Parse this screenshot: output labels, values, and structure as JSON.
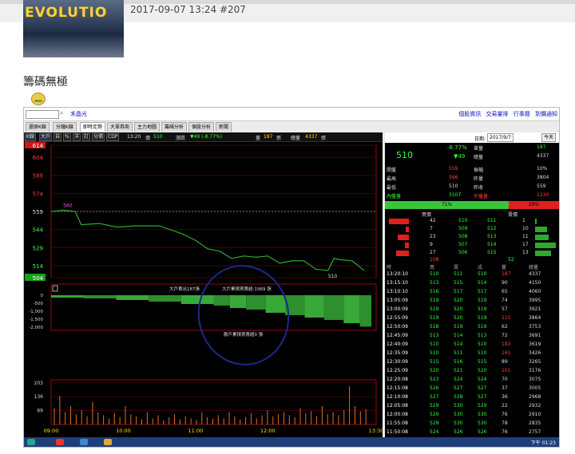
{
  "post": {
    "meta": "2017-09-07 13:24  #207",
    "title": "籌碼無極",
    "avatar_text": "EVOLUTIO"
  },
  "toolbar": {
    "stock_name": "禾晶光",
    "links": "個股資訊 交易量排 行事曆 到價通知"
  },
  "tabs": [
    "還原K線",
    "分鐘K線",
    "即時走勢",
    "大單券商",
    "主力地圖",
    "籌碼分析",
    "個股分析",
    "新聞"
  ],
  "chart_head": {
    "mode_buttons": [
      "K線",
      "大戶",
      "自",
      "%",
      "洋",
      "訂",
      "分價",
      "CDP"
    ],
    "time": "13:20",
    "price_label": "價",
    "price": "510",
    "change_label": "漲跌",
    "change": "▼49 (-8.77%)",
    "volume_label": "量",
    "volume": "187",
    "volume_unit": "張",
    "total_label": "總量",
    "total": "4337",
    "total_unit": "張"
  },
  "chart_data": {
    "type": "line",
    "price_axis_ticks": [
      "614",
      "604",
      "589",
      "574",
      "559",
      "544",
      "529",
      "514",
      "504"
    ],
    "price_line": [
      [
        "09:00",
        559
      ],
      [
        "09:10",
        560
      ],
      [
        "09:20",
        559
      ],
      [
        "09:25",
        548
      ],
      [
        "09:40",
        549
      ],
      [
        "09:55",
        546
      ],
      [
        "10:10",
        547
      ],
      [
        "10:30",
        547
      ],
      [
        "10:50",
        540
      ],
      [
        "11:00",
        535
      ],
      [
        "11:10",
        528
      ],
      [
        "11:20",
        526
      ],
      [
        "11:30",
        520
      ],
      [
        "11:40",
        522
      ],
      [
        "11:50",
        521
      ],
      [
        "12:00",
        522
      ],
      [
        "12:10",
        516
      ],
      [
        "12:20",
        518
      ],
      [
        "12:30",
        518
      ],
      [
        "12:40",
        511
      ],
      [
        "12:50",
        510
      ],
      [
        "12:55",
        520
      ],
      [
        "13:00",
        519
      ],
      [
        "13:10",
        518
      ],
      [
        "13:20",
        510
      ]
    ],
    "label_high": "560",
    "label_low": "510",
    "big_order_axis_ticks": [
      "0",
      "-500",
      "-1,000",
      "-1,500",
      "-2,000"
    ],
    "big_order_note_1": "大戶賣出187張",
    "big_order_note_2": "大戶累積買賣超-1969 張",
    "big_order_note_3": "散戶累積買賣超0 張",
    "volume_axis_ticks": [
      "203",
      "136",
      "69"
    ],
    "time_axis_ticks": [
      "09:00",
      "10:00",
      "11:00",
      "12:00",
      "13:30"
    ]
  },
  "right": {
    "date_label": "日期:",
    "date": "2017/9/7",
    "today_btn": "今天",
    "price": "510",
    "pct": "-8.77%",
    "change": "▼49",
    "stats_left": [
      [
        "開盤",
        "559"
      ],
      [
        "最高",
        "566"
      ],
      [
        "最低",
        "510"
      ],
      [
        "內盤量",
        "3107"
      ]
    ],
    "stats_right": [
      [
        "單量",
        "187"
      ],
      [
        "總量",
        "4337"
      ],
      [
        "振幅",
        "10%"
      ],
      [
        "昨量",
        "3804"
      ],
      [
        "昨收",
        "559"
      ],
      [
        "外盤量",
        "1230"
      ]
    ],
    "ratio_buy": "71%",
    "ratio_sell": "29%",
    "ob_headers": [
      "買價",
      "賣價"
    ],
    "order_book": [
      [
        "42",
        "510",
        "511",
        "1"
      ],
      [
        "7",
        "509",
        "512",
        "10"
      ],
      [
        "23",
        "508",
        "513",
        "11"
      ],
      [
        "9",
        "507",
        "514",
        "17"
      ],
      [
        "27",
        "506",
        "515",
        "13"
      ]
    ],
    "ob_totals": [
      "108",
      "52"
    ],
    "tick_headers": [
      "時",
      "買",
      "賣",
      "成",
      "量",
      "總量"
    ],
    "ticks": [
      [
        "13:20:10",
        "510",
        "511",
        "510",
        "187",
        "4337"
      ],
      [
        "13:15:10",
        "513",
        "515",
        "514",
        "90",
        "4150"
      ],
      [
        "13:10:10",
        "516",
        "517",
        "517",
        "65",
        "4060"
      ],
      [
        "13:05:09",
        "519",
        "520",
        "519",
        "74",
        "3995"
      ],
      [
        "13:00:09",
        "519",
        "520",
        "519",
        "57",
        "3921"
      ],
      [
        "12:55:09",
        "519",
        "520",
        "519",
        "111",
        "3864"
      ],
      [
        "12:50:09",
        "518",
        "519",
        "519",
        "62",
        "3753"
      ],
      [
        "12:45:09",
        "513",
        "514",
        "513",
        "72",
        "3691"
      ],
      [
        "12:40:09",
        "510",
        "514",
        "510",
        "183",
        "3619"
      ],
      [
        "12:35:09",
        "510",
        "511",
        "510",
        "161",
        "3426"
      ],
      [
        "12:30:09",
        "515",
        "516",
        "515",
        "89",
        "3265"
      ],
      [
        "12:25:09",
        "520",
        "521",
        "520",
        "101",
        "3176"
      ],
      [
        "12:20:08",
        "523",
        "524",
        "524",
        "70",
        "3075"
      ],
      [
        "12:15:08",
        "526",
        "527",
        "527",
        "37",
        "3005"
      ],
      [
        "12:10:08",
        "527",
        "528",
        "527",
        "36",
        "2968"
      ],
      [
        "12:05:08",
        "529",
        "530",
        "529",
        "22",
        "2932"
      ],
      [
        "12:00:08",
        "529",
        "530",
        "530",
        "76",
        "2910"
      ],
      [
        "11:55:08",
        "529",
        "530",
        "530",
        "78",
        "2835"
      ],
      [
        "11:50:08",
        "524",
        "526",
        "526",
        "76",
        "2757"
      ]
    ]
  },
  "taskbar": {
    "clock": "下午 01:23"
  }
}
